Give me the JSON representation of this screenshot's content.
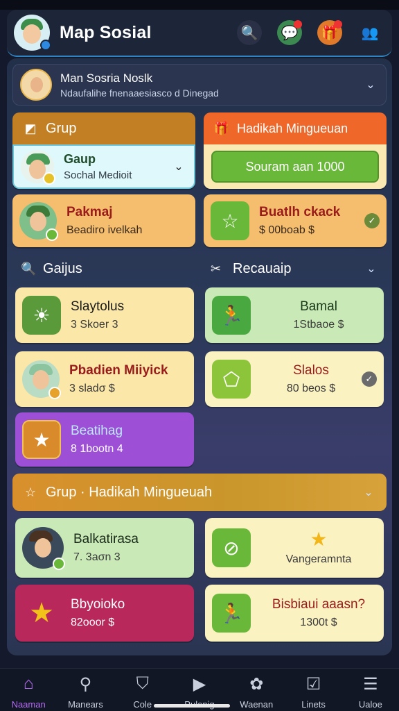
{
  "app": {
    "title": "Map Sosial"
  },
  "topbar_icons": [
    {
      "name": "search-icon",
      "glyph": "🔍",
      "bg": "#2a3045",
      "notify": false
    },
    {
      "name": "chat-icon",
      "glyph": "💬",
      "bg": "#3c8a52",
      "notify": true
    },
    {
      "name": "gift-icon",
      "glyph": "🎁",
      "bg": "#e07a2a",
      "notify": true
    },
    {
      "name": "friends-icon",
      "glyph": "👥",
      "bg": "#1d2538",
      "notify": false
    }
  ],
  "selector": {
    "title": "Man Sosria Noslk",
    "subtitle": "Ndaufalihe fnenaaesiasco d Dinegad"
  },
  "group_left": {
    "header": "Grup",
    "items": [
      {
        "title": "Gaup",
        "subtitle": "Sochal Medioit"
      },
      {
        "title": "Pakmaj",
        "subtitle": "Beadiro ivelkah"
      }
    ]
  },
  "group_right": {
    "header": "Hadikah Mingueuan",
    "button": "Souram aan 1000",
    "item": {
      "title": "Buatlh ckack",
      "subtitle": "$ 00boab $"
    }
  },
  "section_left": {
    "label": "Gaijus"
  },
  "section_right": {
    "label": "Recauaip"
  },
  "grid": [
    {
      "title": "Slaytolus",
      "subtitle": "3 Skoer 3"
    },
    {
      "title": "Bamal",
      "subtitle": "1Stbaoe $"
    },
    {
      "title": "Pbadien Miiyick",
      "subtitle": "3 sladσ $"
    },
    {
      "title": "Slalos",
      "subtitle": "80 beos $"
    },
    {
      "title": "Beatihag",
      "subtitle": "8 1bootn 4"
    }
  ],
  "group_banner": {
    "label": "Grup · Hadikah Mingueuah"
  },
  "bottom_cards": [
    {
      "title": "Balkatirasa",
      "subtitle": "7. 3aσn 3"
    },
    {
      "title": "",
      "subtitle": "Vangeramnta"
    },
    {
      "title": "Bbyoioko",
      "subtitle": "82ooor $"
    },
    {
      "title": "Bisbiaui aaasn?",
      "subtitle": "1300t $"
    }
  ],
  "nav": [
    {
      "label": "Naaman",
      "icon": "home-icon",
      "glyph": "⌂",
      "active": true
    },
    {
      "label": "Manears",
      "icon": "search-icon",
      "glyph": "⚲",
      "active": false
    },
    {
      "label": "Cole",
      "icon": "shield-icon",
      "glyph": "⛉",
      "active": false
    },
    {
      "label": "Pulenig",
      "icon": "play-icon",
      "glyph": "▶",
      "active": false
    },
    {
      "label": "Waenan",
      "icon": "settings-icon",
      "glyph": "✿",
      "active": false
    },
    {
      "label": "Linets",
      "icon": "checklist-icon",
      "glyph": "☑",
      "active": false
    },
    {
      "label": "Ualoe",
      "icon": "menu-icon",
      "glyph": "☰",
      "active": false
    }
  ],
  "colors": {
    "accent_purple": "#b46cf0",
    "orange": "#f0672a",
    "green": "#6ab83a",
    "gold": "#c9972c"
  }
}
